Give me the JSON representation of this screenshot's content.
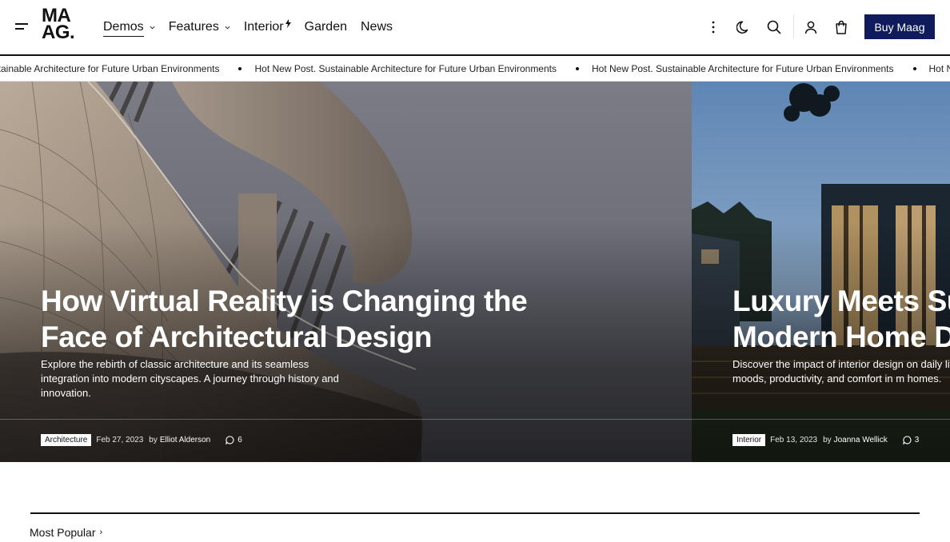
{
  "logo": {
    "line1": "MA",
    "line2": "AG."
  },
  "nav": [
    {
      "label": "Demos",
      "dropdown": true,
      "active": true
    },
    {
      "label": "Features",
      "dropdown": true,
      "active": false
    },
    {
      "label": "Interior",
      "dropdown": false,
      "badge": "bolt-icon",
      "active": false
    },
    {
      "label": "Garden",
      "dropdown": false,
      "active": false
    },
    {
      "label": "News",
      "dropdown": false,
      "active": false
    }
  ],
  "header_icons": [
    "more-vertical-icon",
    "moon-icon",
    "search-icon",
    "user-icon",
    "cart-icon"
  ],
  "buy_button": "Buy Maag",
  "ticker": {
    "prefix": "Hot New Post.",
    "headline": "Sustainable Architecture for Future Urban Environments",
    "items": [
      "Sustainable Architecture for Future Urban Environments",
      "Hot New Post. Sustainable Architecture for Future Urban Environments",
      "Hot New Post. Sustainable Architecture for Future Urban Environments",
      "Hot New Post. Sustainable Archi"
    ]
  },
  "slides": [
    {
      "title_line1": "How Virtual Reality is Changing the",
      "title_line2": "Face of Architectural Design",
      "excerpt": "Explore the rebirth of classic architecture and its seamless integration into modern cityscapes. A journey through history and innovation.",
      "category": "Architecture",
      "date": "Feb 27, 2023",
      "by": "by",
      "author": "Elliot Alderson",
      "comments": "6"
    },
    {
      "title_line1": "Luxury Meets Sus",
      "title_line2": "Modern Home De",
      "excerpt": "Discover the impact of interior design on daily life shape our moods, productivity, and comfort in m homes.",
      "category": "Interior",
      "date": "Feb 13, 2023",
      "by": "by",
      "author": "Joanna Wellick",
      "comments": "3"
    }
  ],
  "section": {
    "title": "Most Popular",
    "arrow": "›"
  },
  "colors": {
    "accent": "#0f1b5c",
    "text": "#111111",
    "background": "#ffffff"
  }
}
